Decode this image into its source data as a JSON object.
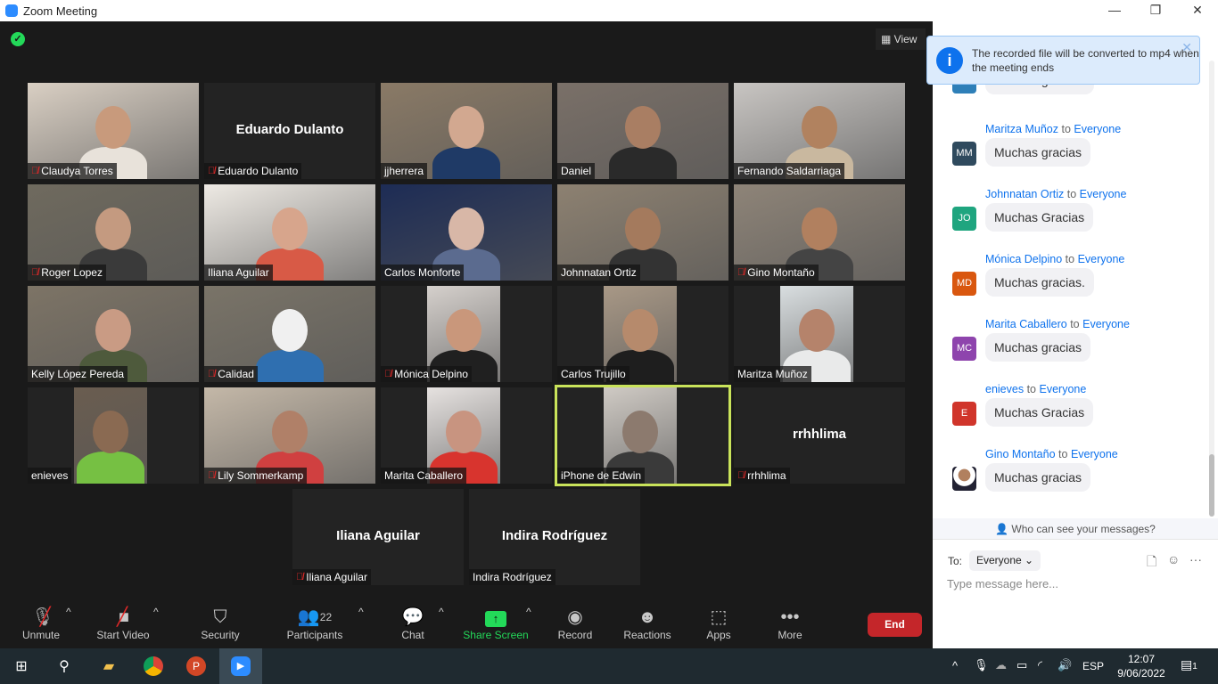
{
  "window": {
    "title": "Zoom Meeting",
    "minimize": "—",
    "restore": "❐",
    "close": "✕"
  },
  "meeting": {
    "view_label": "View",
    "encryption_icon": "shield-check-icon",
    "tiles": [
      {
        "name": "Claudya Torres",
        "muted": true,
        "video": true,
        "bg": "#d9cfc3",
        "skin": "#c89a7c",
        "shirt": "#e8e2da"
      },
      {
        "name": "Eduardo Dulanto",
        "muted": true,
        "video": false
      },
      {
        "name": "jjherrera",
        "muted": false,
        "video": true,
        "bg": "#8a7a66",
        "skin": "#d2a890",
        "shirt": "#1f3a66"
      },
      {
        "name": "Daniel",
        "muted": false,
        "video": true,
        "bg": "#7a7068",
        "skin": "#a97e63",
        "shirt": "#2a2a2a"
      },
      {
        "name": "Fernando Saldarriaga",
        "muted": false,
        "video": true,
        "bg": "#c8c5c2",
        "skin": "#b1825f",
        "shirt": "#c9b89f"
      },
      {
        "name": "Roger Lopez",
        "muted": true,
        "video": true,
        "bg": "#6f6a5e",
        "skin": "#c49a80",
        "shirt": "#3a3a3a"
      },
      {
        "name": "Iliana Aguilar",
        "muted": false,
        "video": true,
        "bg": "#eeeae4",
        "skin": "#d7a58c",
        "shirt": "#d85a46"
      },
      {
        "name": "Carlos Monforte",
        "muted": false,
        "video": true,
        "bg": "#1d2c55",
        "skin": "#d8b7a7",
        "shirt": "#5b6b8f"
      },
      {
        "name": "Johnnatan Ortiz",
        "muted": false,
        "video": true,
        "bg": "#8d8171",
        "skin": "#a47a5d",
        "shirt": "#333"
      },
      {
        "name": "Gino Montaño",
        "muted": true,
        "video": true,
        "bg": "#8e8478",
        "skin": "#b1805f",
        "shirt": "#444"
      },
      {
        "name": "Kelly López Pereda",
        "muted": false,
        "video": true,
        "bg": "#7d7466",
        "skin": "#c99b84",
        "shirt": "#4e5a3c"
      },
      {
        "name": "Calidad",
        "muted": true,
        "video": true,
        "bg": "#7a7468",
        "skin": "#f0f0f0",
        "shirt": "#2f6fb0"
      },
      {
        "name": "Mónica Delpino",
        "muted": true,
        "video": true,
        "bg": "#d5d0cc",
        "skin": "#c9977b",
        "shirt": "#202020",
        "narrow": true
      },
      {
        "name": "Carlos Trujillo",
        "muted": false,
        "video": true,
        "bg": "#a89886",
        "skin": "#b68a6c",
        "shirt": "#1e1e1e",
        "narrow": true
      },
      {
        "name": "Maritza Muñoz",
        "muted": false,
        "video": true,
        "bg": "#d9dee0",
        "skin": "#b5836b",
        "shirt": "#e9eaea",
        "narrow": true
      },
      {
        "name": "enieves",
        "muted": false,
        "video": true,
        "bg": "#6a5d50",
        "skin": "#8a6a52",
        "shirt": "#76c043",
        "narrow": true
      },
      {
        "name": "Lily Sommerkamp",
        "muted": true,
        "video": true,
        "bg": "#c4b8a8",
        "skin": "#b08068",
        "shirt": "#d04040"
      },
      {
        "name": "Marita Caballero",
        "muted": false,
        "video": true,
        "bg": "#e6e2e0",
        "skin": "#c89480",
        "shirt": "#d8342e",
        "narrow": true
      },
      {
        "name": "iPhone de Edwin",
        "muted": false,
        "video": true,
        "bg": "#cfcac4",
        "skin": "#8c7a6e",
        "shirt": "#3a3a3a",
        "narrow": true,
        "active": true
      },
      {
        "name": "rrhhlima",
        "muted": true,
        "video": false
      },
      {
        "name": "Iliana Aguilar",
        "muted": true,
        "video": false
      },
      {
        "name": "Indira Rodríguez",
        "muted": false,
        "video": false
      }
    ]
  },
  "toolbar": {
    "unmute": "Unmute",
    "start_video": "Start Video",
    "security": "Security",
    "participants": "Participants",
    "participants_count": "22",
    "chat": "Chat",
    "share_screen": "Share Screen",
    "record": "Record",
    "reactions": "Reactions",
    "apps": "Apps",
    "more": "More",
    "end": "End",
    "share_color": "#23d959",
    "end_color": "#c4262a"
  },
  "chat": {
    "banner": "The recorded file will be converted to mp4 when the meeting ends",
    "messages": [
      {
        "sender": "",
        "avatar": "CT",
        "color": "#2e7fb8",
        "text": "Muchas gracias!"
      },
      {
        "sender": "Maritza Muñoz",
        "to": "to",
        "recipient": "Everyone",
        "avatar": "MM",
        "color": "#2f4a5e",
        "text": "Muchas gracias"
      },
      {
        "sender": "Johnnatan Ortiz",
        "to": "to",
        "recipient": "Everyone",
        "avatar": "JO",
        "color": "#1fa57f",
        "text": "Muchas Gracias"
      },
      {
        "sender": "Mónica Delpino",
        "to": "to",
        "recipient": "Everyone",
        "avatar": "MD",
        "color": "#d9570f",
        "text": "Muchas gracias."
      },
      {
        "sender": "Marita Caballero",
        "to": "to",
        "recipient": "Everyone",
        "avatar": "MC",
        "color": "#8e44ad",
        "text": "Muchas gracias"
      },
      {
        "sender": "enieves",
        "to": "to",
        "recipient": "Everyone",
        "avatar": "E",
        "color": "#d0352b",
        "text": "Muchas Gracias"
      },
      {
        "sender": "Gino Montaño",
        "to": "to",
        "recipient": "Everyone",
        "avatar": "",
        "color": "#b1805f",
        "text": "Muchas gracias"
      }
    ],
    "who_can_see": "Who can see your messages?",
    "to_label": "To:",
    "to_value": "Everyone",
    "placeholder": "Type message here..."
  },
  "taskbar": {
    "time": "12:07",
    "date": "9/06/2022",
    "language": "ESP",
    "notifications": "1"
  }
}
